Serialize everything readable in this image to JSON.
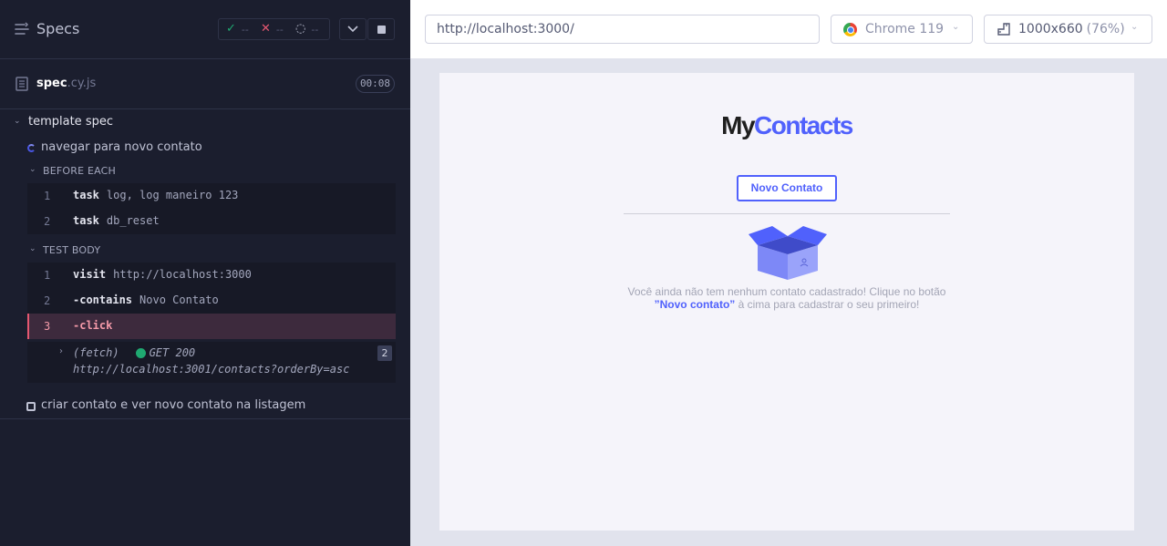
{
  "reporter": {
    "title": "Specs",
    "stats": {
      "passed": "--",
      "failed": "--",
      "pending": "--"
    },
    "file": {
      "name": "spec",
      "ext": ".cy.js",
      "duration": "00:08"
    },
    "suite": {
      "title": "template spec"
    },
    "tests": [
      {
        "title": "navegar para novo contato",
        "state": "running"
      },
      {
        "title": "criar contato e ver novo contato na listagem",
        "state": "pending"
      }
    ],
    "before_each": {
      "label": "BEFORE EACH",
      "commands": [
        {
          "num": "1",
          "name": "task",
          "arg": "log, log maneiro 123"
        },
        {
          "num": "2",
          "name": "task",
          "arg": "db_reset"
        }
      ]
    },
    "test_body": {
      "label": "TEST BODY",
      "commands": [
        {
          "num": "1",
          "name": "visit",
          "arg": "http://localhost:3000"
        },
        {
          "num": "2",
          "name": "-contains",
          "arg": "Novo Contato"
        },
        {
          "num": "3",
          "name": "-click",
          "arg": ""
        }
      ]
    },
    "fetch": {
      "label": "(fetch)",
      "status": "GET 200",
      "url": "http://localhost:3001/contacts?orderBy=asc",
      "count": "2"
    }
  },
  "aut": {
    "url": "http://localhost:3000/",
    "browser": "Chrome 119",
    "viewport": "1000x660",
    "zoom": "(76%)",
    "app": {
      "logo_my": "My",
      "logo_contacts": "Contacts",
      "new_contact_button": "Novo Contato",
      "empty_text_1": "Você ainda não tem nenhum contato cadastrado! Clique no botão ",
      "empty_text_highlight": "”Novo contato”",
      "empty_text_2": " à cima para cadastrar o seu primeiro!"
    }
  },
  "colors": {
    "reporter_bg": "#1b1e2e",
    "pass": "#1fa971",
    "fail": "#e45770",
    "app_accent": "#5061fc"
  }
}
